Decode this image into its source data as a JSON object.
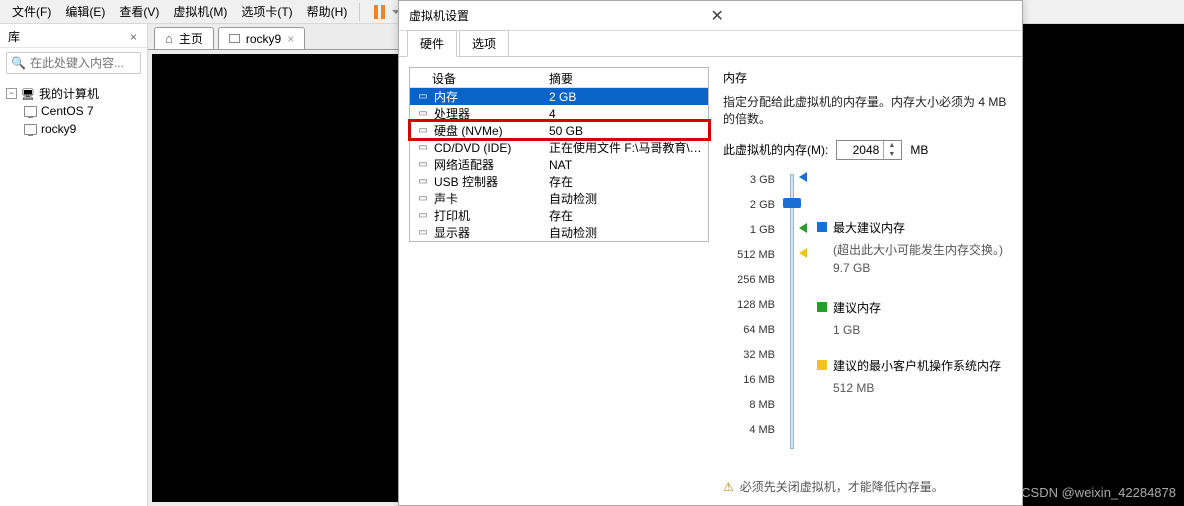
{
  "menu": {
    "file": "文件(F)",
    "edit": "编辑(E)",
    "view": "查看(V)",
    "vm": "虚拟机(M)",
    "tabs": "选项卡(T)",
    "help": "帮助(H)"
  },
  "sidebar": {
    "title": "库",
    "search_placeholder": "在此处键入内容...",
    "root": "我的计算机",
    "items": [
      "CentOS 7",
      "rocky9"
    ]
  },
  "tabs": {
    "home": "主页",
    "vm": "rocky9"
  },
  "dialog": {
    "title": "虚拟机设置",
    "tab_hw": "硬件",
    "tab_opt": "选项",
    "col_device": "设备",
    "col_summary": "摘要",
    "rows": [
      {
        "dev": "内存",
        "sum": "2 GB",
        "sel": true
      },
      {
        "dev": "处理器",
        "sum": "4"
      },
      {
        "dev": "硬盘 (NVMe)",
        "sum": "50 GB",
        "boxed": true
      },
      {
        "dev": "CD/DVD (IDE)",
        "sum": "正在使用文件 F:\\马哥教育\\R..."
      },
      {
        "dev": "网络适配器",
        "sum": "NAT"
      },
      {
        "dev": "USB 控制器",
        "sum": "存在"
      },
      {
        "dev": "声卡",
        "sum": "自动检测"
      },
      {
        "dev": "打印机",
        "sum": "存在"
      },
      {
        "dev": "显示器",
        "sum": "自动检测"
      }
    ]
  },
  "memory": {
    "title": "内存",
    "desc": "指定分配给此虚拟机的内存量。内存大小必须为 4 MB 的倍数。",
    "field_label": "此虚拟机的内存(M):",
    "value": "2048",
    "unit": "MB",
    "ticks": [
      "3 GB",
      "2 GB",
      "1 GB",
      "512 MB",
      "256 MB",
      "128 MB",
      "64 MB",
      "32 MB",
      "16 MB",
      "8 MB",
      "4 MB"
    ],
    "legend_max": "最大建议内存",
    "legend_max_sub": "(超出此大小可能发生内存交换。)",
    "legend_max_val": "9.7 GB",
    "legend_rec": "建议内存",
    "legend_rec_val": "1 GB",
    "legend_min": "建议的最小客户机操作系统内存",
    "legend_min_val": "512 MB",
    "shutdown": "必须先关闭虚拟机，才能降低内存量。"
  },
  "watermark": "CSDN @weixin_42284878"
}
